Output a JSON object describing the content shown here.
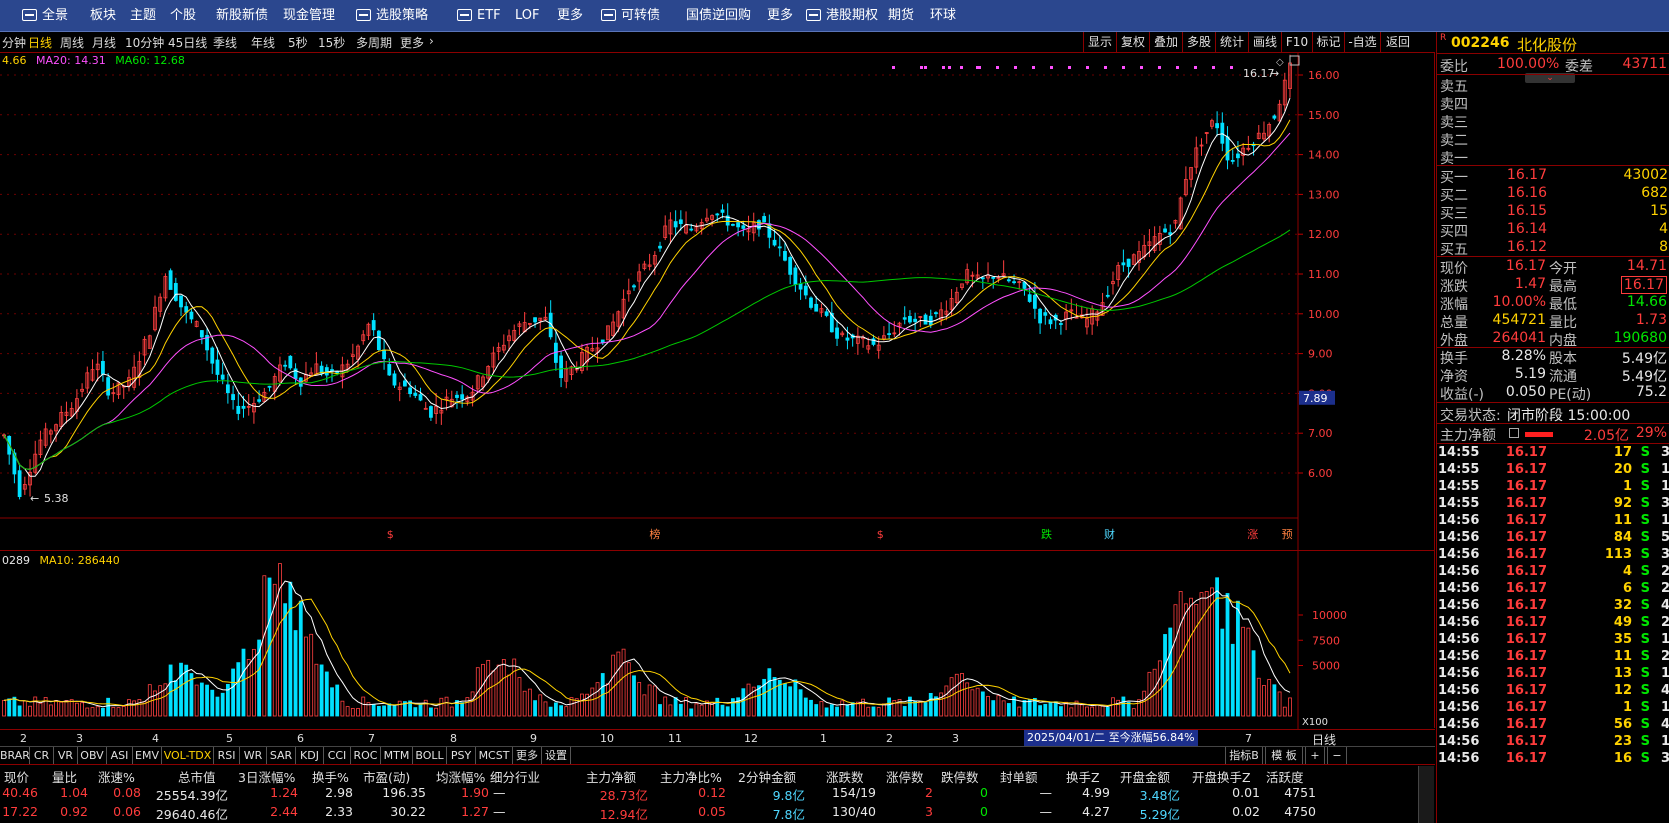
{
  "topnav": [
    {
      "label": "全景",
      "icon": "panorama-icon"
    },
    {
      "label": "板块"
    },
    {
      "label": "主题"
    },
    {
      "label": "个股"
    },
    {
      "label": "新股新债"
    },
    {
      "label": "现金管理"
    },
    {
      "label": "选股策略",
      "icon": "strategy-icon"
    },
    {
      "label": "ETF",
      "icon": "etf-icon"
    },
    {
      "label": "LOF"
    },
    {
      "label": "更多"
    },
    {
      "label": "可转债",
      "icon": "bond-icon"
    },
    {
      "label": "国债逆回购"
    },
    {
      "label": "更多"
    },
    {
      "label": "港股",
      "icon": "hk-icon"
    },
    {
      "label": "期权"
    },
    {
      "label": "期货"
    },
    {
      "label": "环球"
    }
  ],
  "periods": [
    "分钟",
    "日线",
    "周线",
    "月线",
    "10分钟",
    "45日线",
    "季线",
    "年线",
    "5秒",
    "15秒",
    "多周期",
    "更多"
  ],
  "active_period": "日线",
  "right_tools": [
    "显示",
    "复权",
    "叠加",
    "多股",
    "统计",
    "画线",
    "F10",
    "标记",
    "-自选",
    "返回"
  ],
  "ma_legend": {
    "ma5": "4.66",
    "ma20": "MA20: 14.31",
    "ma60": "MA60: 12.68"
  },
  "vol_legend": {
    "vol": "0289",
    "ma10": "MA10: 286440"
  },
  "price_axis": [
    "16.00",
    "15.00",
    "14.00",
    "13.00",
    "12.00",
    "11.00",
    "10.00",
    "9.00",
    "8.00",
    "7.00",
    "6.00"
  ],
  "cursor_price": "7.89",
  "hi_label": "16.17",
  "lo_label": "5.38",
  "vol_axis": [
    "10000",
    "7500",
    "5000"
  ],
  "vol_unit": "X100",
  "event_marks": [
    {
      "text": "$",
      "color": "#ff3c3c"
    },
    {
      "text": "榜",
      "color": "#ff8040"
    },
    {
      "text": "$",
      "color": "#ff3c3c"
    },
    {
      "text": "跌",
      "color": "#00e600"
    },
    {
      "text": "财",
      "color": "#4fd8ff"
    },
    {
      "text": "涨",
      "color": "#ff3c3c"
    },
    {
      "text": "预",
      "color": "#ff8040"
    }
  ],
  "date_ticks": [
    "2",
    "3",
    "4",
    "5",
    "6",
    "7",
    "8",
    "9",
    "10",
    "11",
    "12",
    "1",
    "2",
    "3",
    "7"
  ],
  "range_label": "2025/04/01/二 至今涨幅56.84%",
  "period_label": "日线",
  "indicators": [
    "BRAR",
    "CR",
    "VR",
    "OBV",
    "ASI",
    "EMV",
    "VOL-TDX",
    "RSI",
    "WR",
    "SAR",
    "KDJ",
    "CCI",
    "ROC",
    "MTM",
    "BOLL",
    "PSY",
    "MCST",
    "更多",
    "设置"
  ],
  "active_indicator": "VOL-TDX",
  "ind_right": [
    "指标B",
    "模 板",
    "+",
    "−"
  ],
  "table": {
    "headers": [
      "现价",
      "量比",
      "涨速%",
      "总市值",
      "3日涨幅%",
      "换手%",
      "市盈(动)",
      "均涨幅%",
      "细分行业",
      "主力净额",
      "主力净比%",
      "2分钟金额",
      "涨跌数",
      "涨停数",
      "跌停数",
      "封单额",
      "换手Z",
      "开盘金额",
      "开盘换手Z",
      "活跃度"
    ],
    "rows": [
      [
        "40.46",
        "1.04",
        "0.08",
        "25554.39亿",
        "1.24",
        "2.98",
        "196.35",
        "1.90",
        "—",
        "28.73亿",
        "0.12",
        "9.8亿",
        "154/19",
        "2",
        "0",
        "—",
        "4.99",
        "3.48亿",
        "0.01",
        "4751"
      ],
      [
        "17.22",
        "0.92",
        "0.06",
        "29640.46亿",
        "2.44",
        "2.33",
        "30.22",
        "1.27",
        "—",
        "12.94亿",
        "0.05",
        "7.8亿",
        "130/40",
        "3",
        "0",
        "—",
        "4.27",
        "5.29亿",
        "0.02",
        "4750"
      ]
    ]
  },
  "quote": {
    "code": "002246",
    "name": "北化股份",
    "badge": "R",
    "weibi_label": "委比",
    "weibi": "100.00%",
    "weicha_label": "委差",
    "weicha": "43711",
    "sells": [
      "卖五",
      "卖四",
      "卖三",
      "卖二",
      "卖一"
    ],
    "buys": [
      {
        "l": "买一",
        "p": "16.17",
        "v": "43002"
      },
      {
        "l": "买二",
        "p": "16.16",
        "v": "682"
      },
      {
        "l": "买三",
        "p": "16.15",
        "v": "15"
      },
      {
        "l": "买四",
        "p": "16.14",
        "v": "4"
      },
      {
        "l": "买五",
        "p": "16.12",
        "v": "8"
      }
    ],
    "stats": [
      {
        "l1": "现价",
        "v1": "16.17",
        "c1": "red",
        "l2": "今开",
        "v2": "14.71",
        "c2": "red"
      },
      {
        "l1": "涨跌",
        "v1": "1.47",
        "c1": "red",
        "l2": "最高",
        "v2": "16.17",
        "c2": "red"
      },
      {
        "l1": "涨幅",
        "v1": "10.00%",
        "c1": "red",
        "l2": "最低",
        "v2": "14.66",
        "c2": "grn"
      },
      {
        "l1": "总量",
        "v1": "454721",
        "c1": "yel",
        "l2": "量比",
        "v2": "1.73",
        "c2": "red"
      },
      {
        "l1": "外盘",
        "v1": "264041",
        "c1": "red",
        "l2": "内盘",
        "v2": "190680",
        "c2": "grn"
      },
      {
        "l1": "换手",
        "v1": "8.28%",
        "c1": "wht",
        "l2": "股本",
        "v2": "5.49亿",
        "c2": "wht"
      },
      {
        "l1": "净资",
        "v1": "5.19",
        "c1": "wht",
        "l2": "流通",
        "v2": "5.49亿",
        "c2": "wht"
      },
      {
        "l1": "收益(-)",
        "v1": "0.050",
        "c1": "wht",
        "l2": "PE(动)",
        "v2": "75.2",
        "c2": "wht"
      }
    ],
    "status_label": "交易状态:",
    "status": "闭市阶段 15:00:00",
    "flow_label": "主力净额",
    "flow_value": "2.05亿",
    "flow_pct": "29%",
    "ticks": [
      [
        "14:55",
        "16.17",
        "17",
        "S",
        "3"
      ],
      [
        "14:55",
        "16.17",
        "20",
        "S",
        "1"
      ],
      [
        "14:55",
        "16.17",
        "1",
        "S",
        "1"
      ],
      [
        "14:55",
        "16.17",
        "92",
        "S",
        "3"
      ],
      [
        "14:56",
        "16.17",
        "11",
        "S",
        "1"
      ],
      [
        "14:56",
        "16.17",
        "84",
        "S",
        "5"
      ],
      [
        "14:56",
        "16.17",
        "113",
        "S",
        "3"
      ],
      [
        "14:56",
        "16.17",
        "4",
        "S",
        "2"
      ],
      [
        "14:56",
        "16.17",
        "6",
        "S",
        "2"
      ],
      [
        "14:56",
        "16.17",
        "32",
        "S",
        "4"
      ],
      [
        "14:56",
        "16.17",
        "49",
        "S",
        "2"
      ],
      [
        "14:56",
        "16.17",
        "35",
        "S",
        "1"
      ],
      [
        "14:56",
        "16.17",
        "11",
        "S",
        "2"
      ],
      [
        "14:56",
        "16.17",
        "13",
        "S",
        "1"
      ],
      [
        "14:56",
        "16.17",
        "12",
        "S",
        "4"
      ],
      [
        "14:56",
        "16.17",
        "1",
        "S",
        "1"
      ],
      [
        "14:56",
        "16.17",
        "56",
        "S",
        "4"
      ],
      [
        "14:56",
        "16.17",
        "23",
        "S",
        "1"
      ],
      [
        "14:56",
        "16.17",
        "16",
        "S",
        "3"
      ]
    ]
  }
}
